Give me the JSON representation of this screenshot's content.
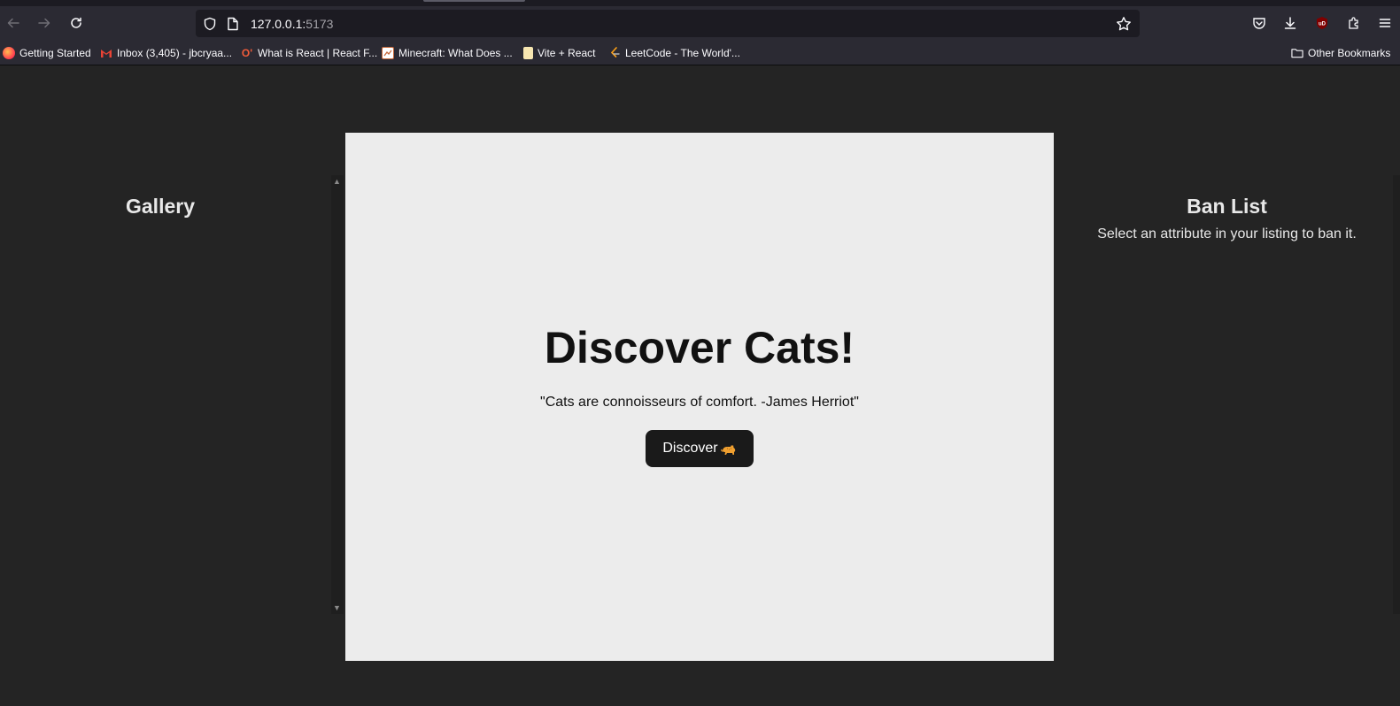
{
  "browser": {
    "url_host": "127.0.0.1:",
    "url_port": "5173",
    "bookmarks": [
      {
        "label": "Getting Started",
        "icon": "firefox-icon"
      },
      {
        "label": "Inbox (3,405) - jbcryaa...",
        "icon": "gmail-icon"
      },
      {
        "label": "What is React | React F...",
        "icon": "react-course-icon"
      },
      {
        "label": "Minecraft: What Does ...",
        "icon": "minecraft-icon"
      },
      {
        "label": "Vite + React",
        "icon": "vite-icon"
      },
      {
        "label": "LeetCode - The World'...",
        "icon": "leetcode-icon"
      }
    ],
    "other_bookmarks": "Other Bookmarks"
  },
  "page": {
    "gallery_title": "Gallery",
    "ban_title": "Ban List",
    "ban_subtitle": "Select an attribute in your listing to ban it.",
    "card": {
      "title": "Discover Cats!",
      "quote": "\"Cats are connoisseurs of comfort. -James Herriot\"",
      "button_label": "Discover"
    }
  },
  "colors": {
    "page_bg": "#242424",
    "card_bg": "#ececec",
    "button_bg": "#1a1a1a",
    "browser_chrome": "#2b2a33"
  }
}
